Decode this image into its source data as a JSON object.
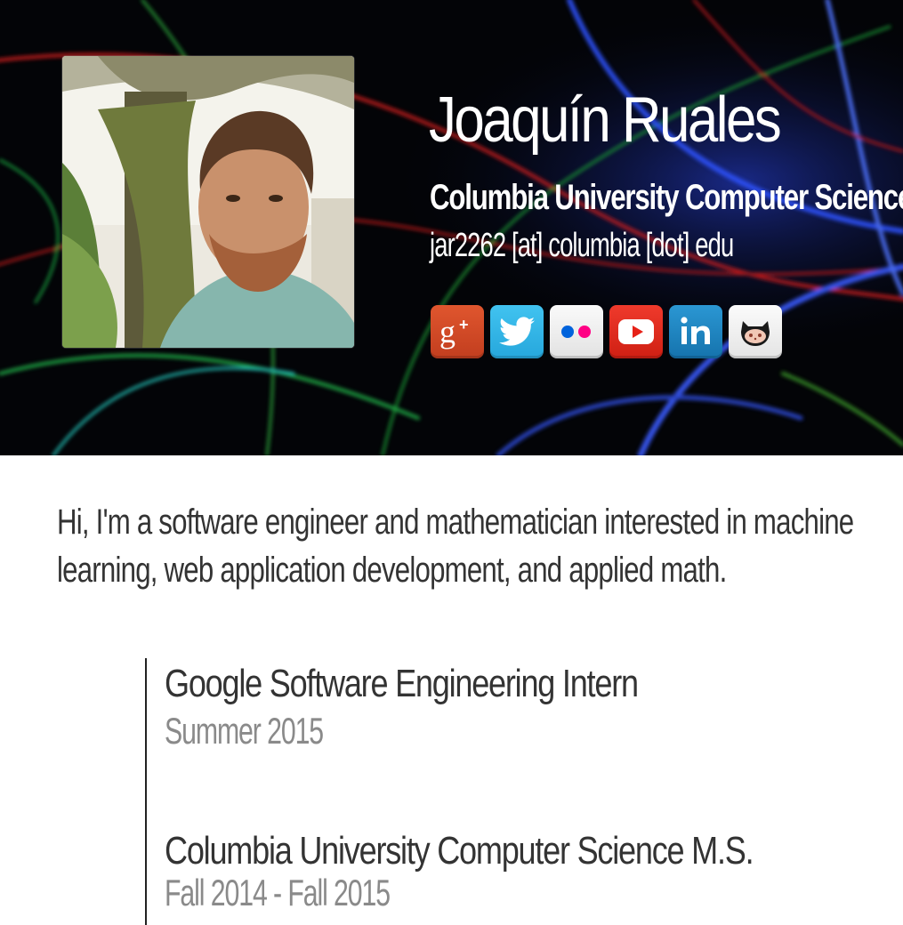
{
  "profile": {
    "name": "Joaquín Ruales",
    "affiliation": "Columbia University Computer Science",
    "email": "jar2262 [at] columbia [dot] edu"
  },
  "social_links": [
    {
      "name": "google-plus",
      "icon": "google-plus-icon",
      "color": "#dd4b39"
    },
    {
      "name": "twitter",
      "icon": "twitter-icon",
      "color": "#33b5e5"
    },
    {
      "name": "flickr",
      "icon": "flickr-icon",
      "color": "#f3f3f3"
    },
    {
      "name": "youtube",
      "icon": "youtube-icon",
      "color": "#e62117"
    },
    {
      "name": "linkedin",
      "icon": "linkedin-icon",
      "color": "#1e88c7"
    },
    {
      "name": "github",
      "icon": "github-icon",
      "color": "#f3f3f3"
    }
  ],
  "intro": "Hi, I'm a software engineer and mathematician interested in machine learning, web application development, and applied math.",
  "timeline": [
    {
      "title": "Google Software Engineering Intern",
      "date": "Summer 2015"
    },
    {
      "title": "Columbia University Computer Science M.S.",
      "date": "Fall 2014 - Fall 2015"
    }
  ]
}
